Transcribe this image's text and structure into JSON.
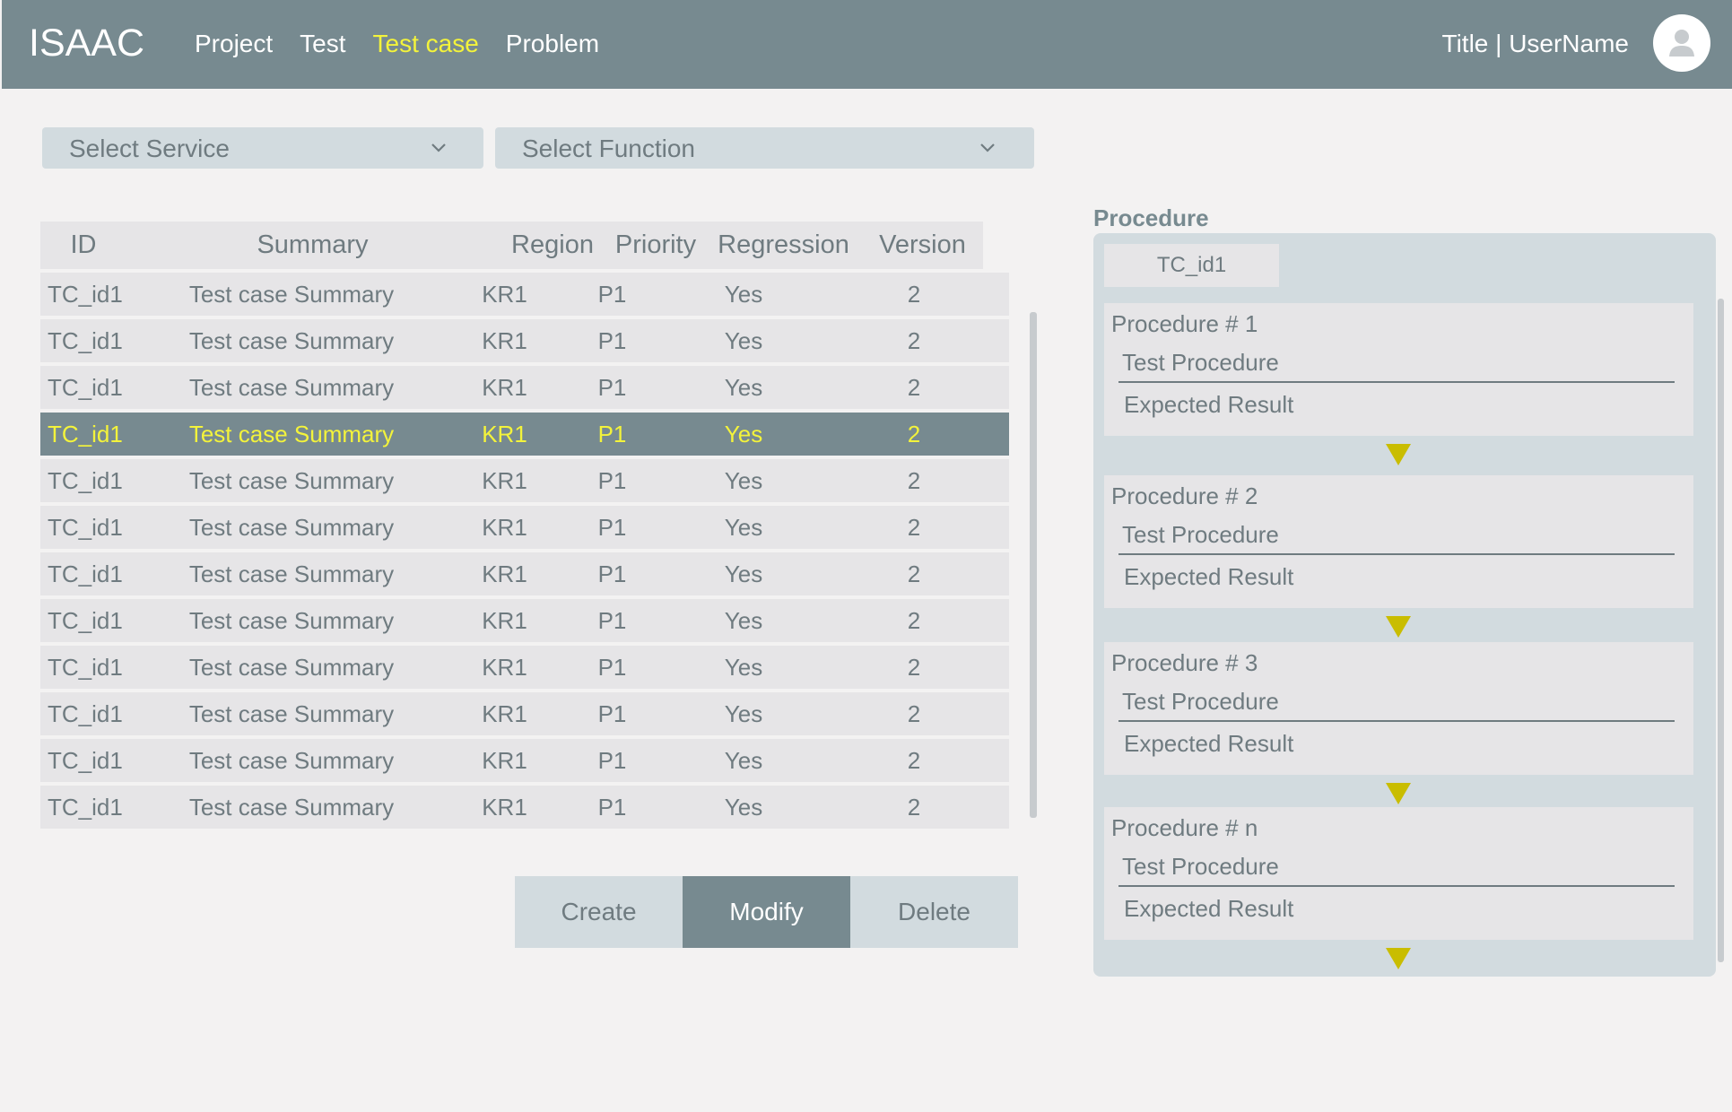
{
  "app": {
    "logo": "ISAAC"
  },
  "nav": {
    "items": [
      {
        "label": "Project"
      },
      {
        "label": "Test"
      },
      {
        "label": "Test case"
      },
      {
        "label": "Problem"
      }
    ]
  },
  "user": {
    "label": "Title | UserName"
  },
  "filters": {
    "service": "Select Service",
    "function": "Select Function"
  },
  "table": {
    "headers": {
      "id": "ID",
      "summary": "Summary",
      "region": "Region",
      "priority": "Priority",
      "regression": "Regression",
      "version": "Version"
    },
    "rows": [
      {
        "id": "TC_id1",
        "summary": "Test case Summary",
        "region": "KR1",
        "priority": "P1",
        "regression": "Yes",
        "version": "2"
      },
      {
        "id": "TC_id1",
        "summary": "Test case Summary",
        "region": "KR1",
        "priority": "P1",
        "regression": "Yes",
        "version": "2"
      },
      {
        "id": "TC_id1",
        "summary": "Test case Summary",
        "region": "KR1",
        "priority": "P1",
        "regression": "Yes",
        "version": "2"
      },
      {
        "id": "TC_id1",
        "summary": "Test case Summary",
        "region": "KR1",
        "priority": "P1",
        "regression": "Yes",
        "version": "2"
      },
      {
        "id": "TC_id1",
        "summary": "Test case Summary",
        "region": "KR1",
        "priority": "P1",
        "regression": "Yes",
        "version": "2"
      },
      {
        "id": "TC_id1",
        "summary": "Test case Summary",
        "region": "KR1",
        "priority": "P1",
        "regression": "Yes",
        "version": "2"
      },
      {
        "id": "TC_id1",
        "summary": "Test case Summary",
        "region": "KR1",
        "priority": "P1",
        "regression": "Yes",
        "version": "2"
      },
      {
        "id": "TC_id1",
        "summary": "Test case Summary",
        "region": "KR1",
        "priority": "P1",
        "regression": "Yes",
        "version": "2"
      },
      {
        "id": "TC_id1",
        "summary": "Test case Summary",
        "region": "KR1",
        "priority": "P1",
        "regression": "Yes",
        "version": "2"
      },
      {
        "id": "TC_id1",
        "summary": "Test case Summary",
        "region": "KR1",
        "priority": "P1",
        "regression": "Yes",
        "version": "2"
      },
      {
        "id": "TC_id1",
        "summary": "Test case Summary",
        "region": "KR1",
        "priority": "P1",
        "regression": "Yes",
        "version": "2"
      },
      {
        "id": "TC_id1",
        "summary": "Test case Summary",
        "region": "KR1",
        "priority": "P1",
        "regression": "Yes",
        "version": "2"
      }
    ]
  },
  "actions": {
    "create": "Create",
    "modify": "Modify",
    "delete": "Delete"
  },
  "procedure": {
    "title": "Procedure",
    "tab": "TC_id1",
    "items": [
      {
        "number": "Procedure # 1",
        "test": "Test Procedure",
        "expected": "Expected Result"
      },
      {
        "number": "Procedure # 2",
        "test": "Test Procedure",
        "expected": "Expected Result"
      },
      {
        "number": "Procedure # 3",
        "test": "Test Procedure",
        "expected": "Expected Result"
      },
      {
        "number": "Procedure # n",
        "test": "Test Procedure",
        "expected": "Expected Result"
      }
    ]
  },
  "colors": {
    "header_bg": "#778a90",
    "accent": "#f3f33b",
    "arrow": "#c9bd00",
    "panel": "#d2dbdf",
    "row_bg": "#e6e5e7"
  }
}
